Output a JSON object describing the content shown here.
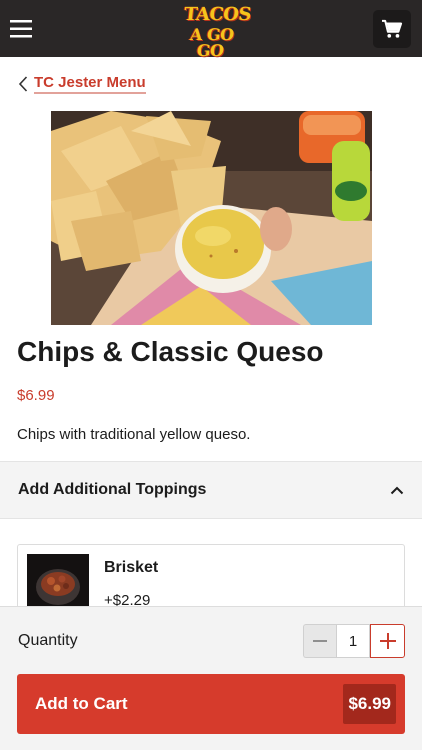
{
  "header": {
    "logo_line1": "TACOS",
    "logo_line2": "A GO GO",
    "menu_icon": "hamburger-menu-icon",
    "cart_icon": "shopping-cart-icon",
    "bg_color": "#2a2727",
    "logo_color": "#f4c51c"
  },
  "back_link": {
    "label": "TC Jester Menu",
    "icon": "chevron-left-icon",
    "color": "#c93c2c"
  },
  "product": {
    "title": "Chips & Classic Queso",
    "price": "$6.99",
    "description": "Chips with traditional yellow queso."
  },
  "toppings_section": {
    "title": "Add Additional Toppings",
    "icon": "chevron-up-icon",
    "items": [
      {
        "name": "Brisket",
        "price": "+$2.29"
      }
    ]
  },
  "order": {
    "quantity_label": "Quantity",
    "quantity_value": "1",
    "minus_icon": "minus-icon",
    "plus_icon": "plus-icon",
    "add_button_label": "Add to Cart",
    "total": "$6.99",
    "accent": "#d63b2c"
  }
}
